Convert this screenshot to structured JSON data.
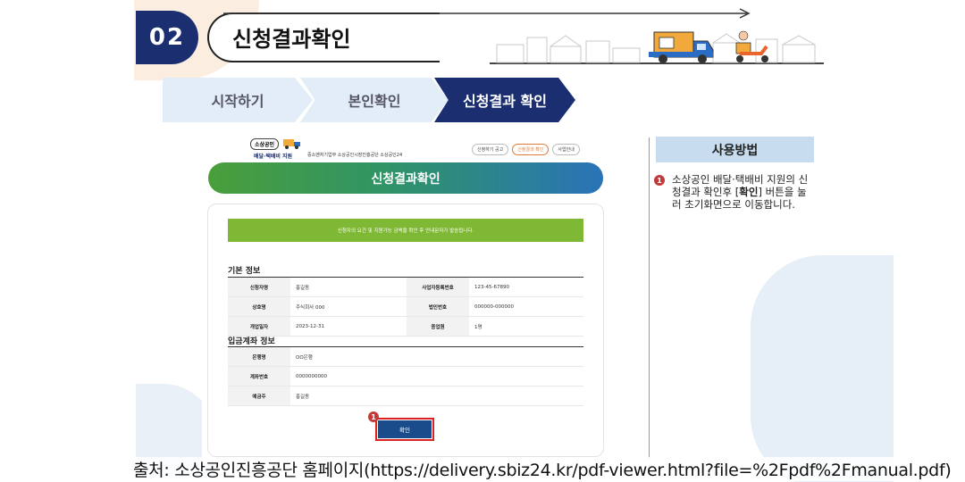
{
  "header": {
    "section_number": "02",
    "title": "신청결과확인"
  },
  "steps": [
    {
      "label": "시작하기",
      "active": false
    },
    {
      "label": "본인확인",
      "active": false
    },
    {
      "label": "신청결과 확인",
      "active": true
    }
  ],
  "screenshot": {
    "logo_badge": "소상공인",
    "logo_text": "배달·택배비 지원",
    "orgs": "중소벤처기업부  소상공인시장진흥공단  소상공인24",
    "nav": [
      "신청하기 공고",
      "신청결과 확인",
      "사업안내"
    ],
    "banner_title": "신청결과확인",
    "notice": "신청자의 요건 및 지원가능 금액을 확인 후 안내문자가 발송됩니다.",
    "basic_info": {
      "title": "기본 정보",
      "rows": [
        {
          "k1": "신청자명",
          "v1": "홍길동",
          "k2": "사업자등록번호",
          "v2": "123-45-67890"
        },
        {
          "k1": "상호명",
          "v1": "주식회사 000",
          "k2": "법인번호",
          "v2": "000000-000000"
        },
        {
          "k1": "개업일자",
          "v1": "2023-12-31",
          "k2": "종업원",
          "v2": "1명"
        }
      ]
    },
    "bank_info": {
      "title": "입금계좌 정보",
      "rows": [
        {
          "k": "은행명",
          "v": "OO은행"
        },
        {
          "k": "계좌번호",
          "v": "0000000000"
        },
        {
          "k": "예금주",
          "v": "홍길동"
        }
      ]
    },
    "confirm_label": "확인",
    "marker": "1"
  },
  "guide": {
    "title": "사용방법",
    "marker": "1",
    "text_before": "소상공인 배달·택배비 지원의 신청결과 확인후 [",
    "text_bold": "확인",
    "text_after": "] 버튼을 눌러 초기화면으로 이동합니다."
  },
  "caption": "출처: 소상공인진흥공단 홈페이지(https://delivery.sbiz24.kr/pdf-viewer.html?file=%2Fpdf%2Fmanual.pdf)",
  "colors": {
    "navy": "#1a2e70",
    "step_inactive": "#e3edf7",
    "notice_green": "#7fb834",
    "guide_header": "#c8dcef",
    "marker_red": "#c23a3a"
  }
}
